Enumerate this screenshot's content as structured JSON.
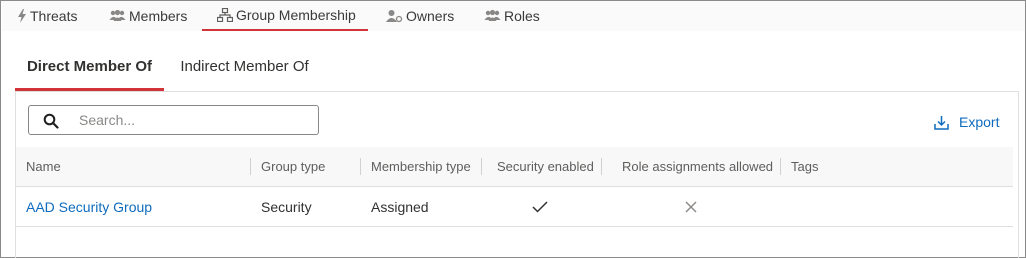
{
  "top_tabs": [
    {
      "label": "Threats",
      "icon": "lightning-icon"
    },
    {
      "label": "Members",
      "icon": "people-group-icon"
    },
    {
      "label": "Group Membership",
      "icon": "org-chart-icon",
      "active": true
    },
    {
      "label": "Owners",
      "icon": "owner-icon"
    },
    {
      "label": "Roles",
      "icon": "people-group-icon"
    }
  ],
  "sub_tabs": [
    {
      "label": "Direct Member Of",
      "active": true
    },
    {
      "label": "Indirect Member Of"
    }
  ],
  "search": {
    "placeholder": "Search...",
    "value": ""
  },
  "export": {
    "label": "Export"
  },
  "table": {
    "columns": [
      "Name",
      "Group type",
      "Membership type",
      "Security enabled",
      "Role assignments allowed",
      "Tags"
    ],
    "rows": [
      {
        "name": "AAD Security Group",
        "group_type": "Security",
        "membership_type": "Assigned",
        "security_enabled": true,
        "role_assignments_allowed": false,
        "tags": ""
      }
    ]
  },
  "colors": {
    "accent": "#d13438",
    "link": "#0f6cbd",
    "border": "#8a8a8a"
  }
}
